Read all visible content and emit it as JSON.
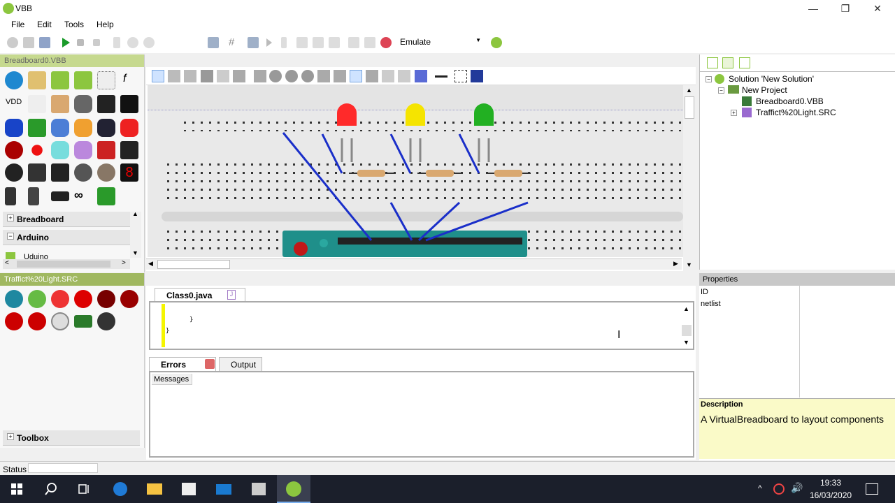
{
  "window": {
    "title": "VBB",
    "min": "—",
    "max": "❐",
    "close": "✕"
  },
  "menu": [
    "File",
    "Edit",
    "Tools",
    "Help"
  ],
  "toolbar": {
    "mode_value": "Emulate"
  },
  "breadboard_panel": {
    "title": "Breadboard0.VBB"
  },
  "categories": {
    "breadboard": "Breadboard",
    "arduino": "Arduino",
    "arduino_item": "Uduino"
  },
  "breadboard_labels": {
    "vdd": "VDD"
  },
  "solution": {
    "root": "Solution 'New Solution'",
    "project": "New Project",
    "files": [
      "Breadboard0.VBB",
      "Traffict%20Light.SRC"
    ]
  },
  "src_panel": {
    "title": "Traffict%20Light.SRC",
    "toolbox": "Toolbox"
  },
  "editor": {
    "tab": "Class0.java",
    "lines": [
      "}",
      "}"
    ]
  },
  "bottom_tabs": {
    "errors": "Errors",
    "output": "Output",
    "messages_header": "Messages"
  },
  "properties": {
    "title": "Properties",
    "rows": [
      "ID",
      "netlist"
    ],
    "description_label": "Description",
    "description_text": "A VirtualBreadboard to layout components"
  },
  "status": {
    "label": "Status"
  },
  "taskbar": {
    "time": "19:33",
    "date": "16/03/2020"
  },
  "colors": {
    "accent": "#8cc63f",
    "panel_header": "#c6d98f",
    "led_red": "#ff2a2a",
    "led_yellow": "#f5e400",
    "led_green": "#22b022",
    "wire": "#1a2fc9",
    "arduino": "#1f8f8a"
  }
}
